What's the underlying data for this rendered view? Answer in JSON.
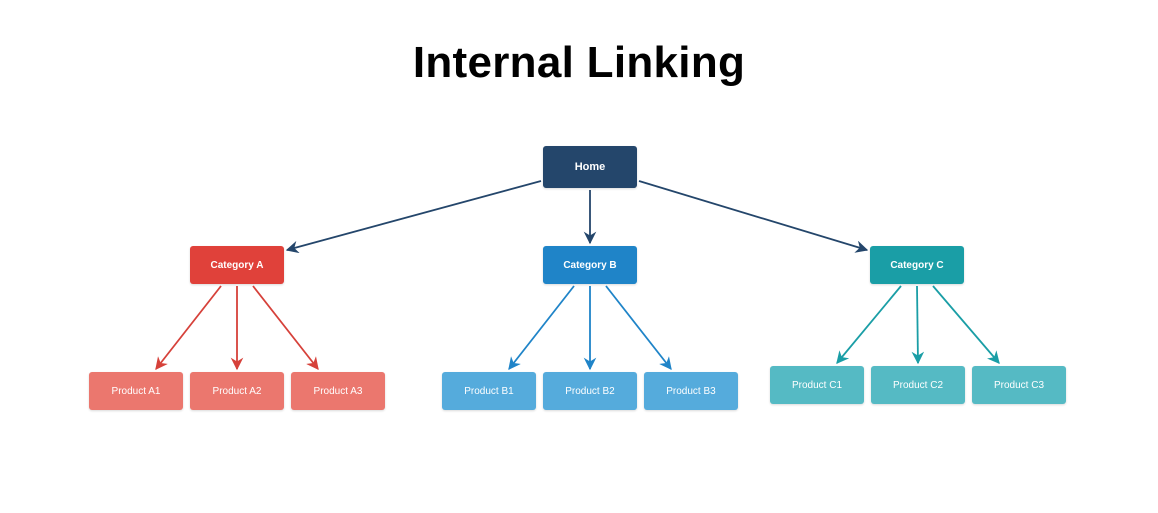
{
  "title": "Internal Linking",
  "colors": {
    "edge_home": "#24466b",
    "edge_a": "#d6413a",
    "edge_b": "#1f84c8",
    "edge_c": "#1a9ea6"
  },
  "home": {
    "id": "home",
    "label": "Home",
    "color": "#24466b"
  },
  "categories": [
    {
      "id": "cat-a",
      "label": "Category A",
      "color": "#e0413a",
      "product_color": "#eb776e",
      "edge_color": "#d6413a",
      "products": [
        {
          "id": "pa1",
          "label": "Product A1"
        },
        {
          "id": "pa2",
          "label": "Product A2"
        },
        {
          "id": "pa3",
          "label": "Product A3"
        }
      ]
    },
    {
      "id": "cat-b",
      "label": "Category B",
      "color": "#1f84c8",
      "product_color": "#55abdc",
      "edge_color": "#1f84c8",
      "products": [
        {
          "id": "pb1",
          "label": "Product B1"
        },
        {
          "id": "pb2",
          "label": "Product B2"
        },
        {
          "id": "pb3",
          "label": "Product B3"
        }
      ]
    },
    {
      "id": "cat-c",
      "label": "Category C",
      "color": "#1a9ea6",
      "product_color": "#55bac4",
      "edge_color": "#1a9ea6",
      "products": [
        {
          "id": "pc1",
          "label": "Product C1"
        },
        {
          "id": "pc2",
          "label": "Product C2"
        },
        {
          "id": "pc3",
          "label": "Product C3"
        }
      ]
    }
  ]
}
